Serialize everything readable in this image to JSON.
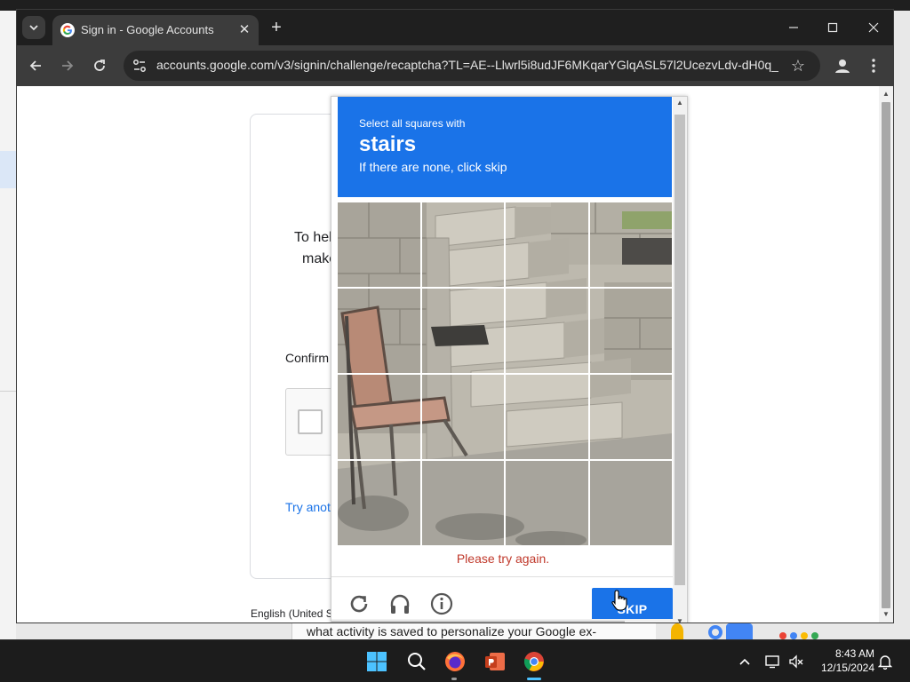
{
  "browser": {
    "tab_title": "Sign in - Google Accounts",
    "url": "accounts.google.com/v3/signin/challenge/recaptcha?TL=AE--Llwrl5i8udJF6MKqarYGlqASL57l2UcezvLdv-dH0q_..."
  },
  "signin": {
    "line1": "To hel",
    "line2": "make",
    "confirm": "Confirm",
    "try_another": "Try anot",
    "language": "English (United S"
  },
  "captcha": {
    "instruction": "Select all squares with",
    "keyword": "stairs",
    "hint": "If there are none, click skip",
    "error": "Please try again.",
    "skip_label": "SKIP",
    "tiles": [
      "1",
      "2",
      "3",
      "4",
      "5",
      "6",
      "7",
      "8",
      "9",
      "10",
      "11",
      "12",
      "13",
      "14",
      "15",
      "16"
    ]
  },
  "background": {
    "behind_text": "what activity is saved to personalize your Google ex-"
  },
  "taskbar": {
    "time": "8:43 AM",
    "date": "12/15/2024",
    "apps": [
      "start-icon",
      "search-icon",
      "firefox-icon",
      "powerpoint-icon",
      "chrome-icon"
    ]
  },
  "colors": {
    "captcha_blue": "#1a73e8",
    "error_red": "#c0392b",
    "chrome_dark": "#1f1f1f"
  }
}
